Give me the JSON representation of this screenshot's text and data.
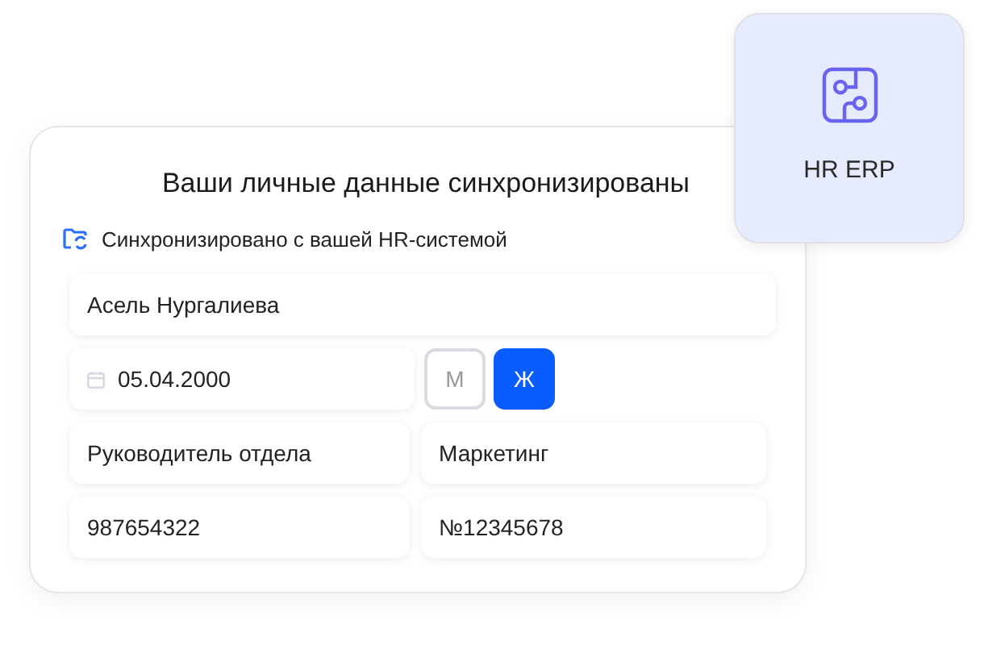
{
  "card": {
    "title": "Ваши личные данные синхронизированы",
    "sync_note": "Синхронизировано с вашей HR-системой"
  },
  "name": "Асель Нургалиева",
  "birth_date": "05.04.2000",
  "gender_options": [
    {
      "label": "М",
      "selected": false
    },
    {
      "label": "Ж",
      "selected": true
    }
  ],
  "position": "Руководитель отдела",
  "department": "Маркетинг",
  "phone": "987654322",
  "document_number": "№12345678",
  "integration": {
    "label": "HR ERP"
  }
}
